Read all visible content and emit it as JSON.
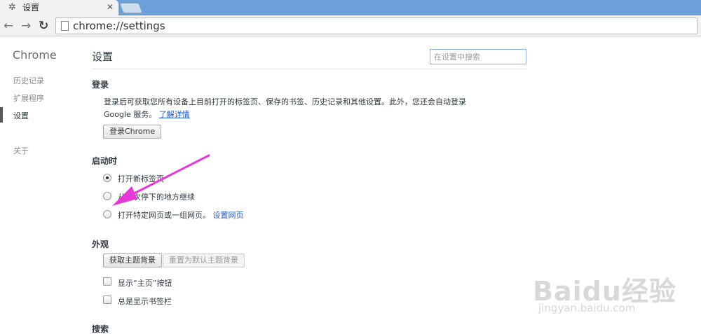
{
  "browser": {
    "tab_title": "设置",
    "tab_icon": "gear-icon",
    "tab_close": "✕",
    "url": "chrome://settings"
  },
  "sidebar": {
    "title": "Chrome",
    "items": [
      {
        "label": "历史记录"
      },
      {
        "label": "扩展程序"
      },
      {
        "label": "设置"
      },
      {
        "label": "关于"
      }
    ]
  },
  "main": {
    "title": "设置",
    "search_placeholder": "在设置中搜索",
    "signin": {
      "title": "登录",
      "desc_line1": "登录后可获取您所有设备上目前打开的标签页、保存的书签、历史记录和其他设置。此外，您还会自动登录",
      "desc_line2": "Google 服务。",
      "learn_more": "了解详情",
      "button": "登录Chrome"
    },
    "startup": {
      "title": "启动时",
      "options": [
        {
          "label": "打开新标签页",
          "checked": true
        },
        {
          "label": "从上次停下的地方继续",
          "checked": false
        },
        {
          "label": "打开特定网页或一组网页。",
          "checked": false
        }
      ],
      "set_pages_link": "设置网页"
    },
    "appearance": {
      "title": "外观",
      "get_themes": "获取主题背景",
      "reset_theme": "重置为默认主题背景",
      "show_home": "显示“主页”按钮",
      "show_bookmarks": "总是显示书签栏"
    },
    "search": {
      "title": "搜索"
    }
  },
  "watermark": {
    "logo": "Baidu经验",
    "sub": "jingyan.baidu.com"
  },
  "colors": {
    "accent": "#1a56c9",
    "annotation": "#e53ad6",
    "tabstrip": "#6ba0d9"
  }
}
